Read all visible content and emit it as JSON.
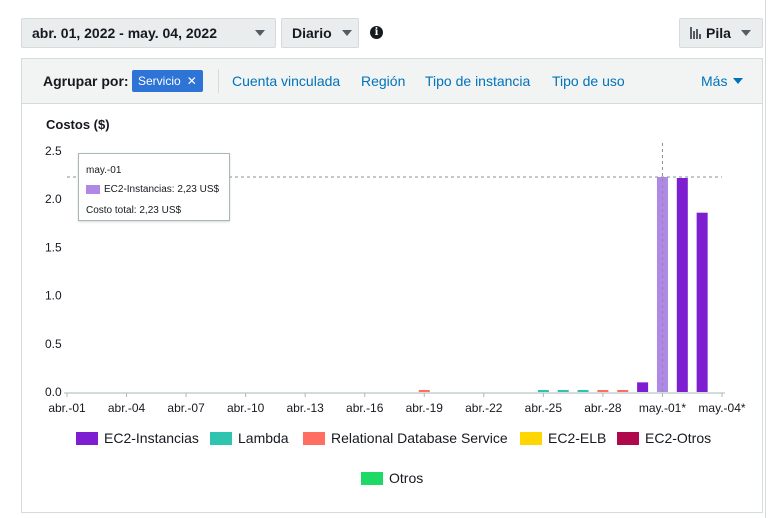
{
  "toolbar": {
    "date_range": "abr. 01, 2022 - may. 04, 2022",
    "granularity": "Diario",
    "chart_style": "Pila"
  },
  "group_by": {
    "label": "Agrupar por:",
    "chip": "Servicio",
    "links": [
      "Cuenta vinculada",
      "Región",
      "Tipo de instancia",
      "Tipo de uso"
    ],
    "more": "Más"
  },
  "tooltip": {
    "date": "may.-01",
    "series_line": "EC2-Instancias: 2,23 US$",
    "total_line": "Costo total: 2,23 US$"
  },
  "colors": {
    "EC2-Instancias": "#7d1fd1",
    "EC2-Instancias-highlight": "#b088e6",
    "Lambda": "#2ec4b0",
    "Relational Database Service": "#ff6e60",
    "EC2-ELB": "#ffd600",
    "EC2-Otros": "#b0084d",
    "Otros": "#1fd966"
  },
  "chart_data": {
    "type": "bar",
    "stacked": true,
    "title": "",
    "ylabel": "Costos ($)",
    "ylim": [
      0,
      2.5
    ],
    "yticks": [
      "0.0",
      "0.5",
      "1.0",
      "1.5",
      "2.0",
      "2.5"
    ],
    "x_tick_labels": [
      "abr.-01",
      "abr.-04",
      "abr.-07",
      "abr.-10",
      "abr.-13",
      "abr.-16",
      "abr.-19",
      "abr.-22",
      "abr.-25",
      "abr.-28",
      "may.-01*",
      "may.-04*"
    ],
    "categories": [
      "abr.-01",
      "abr.-02",
      "abr.-03",
      "abr.-04",
      "abr.-05",
      "abr.-06",
      "abr.-07",
      "abr.-08",
      "abr.-09",
      "abr.-10",
      "abr.-11",
      "abr.-12",
      "abr.-13",
      "abr.-14",
      "abr.-15",
      "abr.-16",
      "abr.-17",
      "abr.-18",
      "abr.-19",
      "abr.-20",
      "abr.-21",
      "abr.-22",
      "abr.-23",
      "abr.-24",
      "abr.-25",
      "abr.-26",
      "abr.-27",
      "abr.-28",
      "abr.-29",
      "abr.-30",
      "may.-01",
      "may.-02",
      "may.-03",
      "may.-04"
    ],
    "series": [
      {
        "name": "EC2-Instancias",
        "values": [
          0,
          0,
          0,
          0,
          0,
          0,
          0,
          0,
          0,
          0,
          0,
          0,
          0,
          0,
          0,
          0,
          0,
          0,
          0,
          0,
          0,
          0,
          0,
          0,
          0,
          0,
          0,
          0,
          0,
          0.1,
          2.23,
          2.22,
          1.86,
          0
        ]
      },
      {
        "name": "Lambda",
        "values": [
          0,
          0,
          0,
          0,
          0,
          0,
          0,
          0,
          0,
          0,
          0,
          0,
          0,
          0,
          0,
          0,
          0,
          0,
          0,
          0,
          0,
          0,
          0,
          0,
          0.01,
          0.01,
          0.01,
          0,
          0,
          0,
          0,
          0,
          0,
          0
        ]
      },
      {
        "name": "Relational Database Service",
        "values": [
          0,
          0,
          0,
          0,
          0,
          0,
          0,
          0,
          0,
          0,
          0,
          0,
          0,
          0,
          0,
          0,
          0,
          0,
          0.01,
          0,
          0,
          0,
          0,
          0,
          0,
          0,
          0,
          0.01,
          0.01,
          0,
          0,
          0,
          0,
          0
        ]
      },
      {
        "name": "EC2-ELB",
        "values": [
          0,
          0,
          0,
          0,
          0,
          0,
          0,
          0,
          0,
          0,
          0,
          0,
          0,
          0,
          0,
          0,
          0,
          0,
          0,
          0,
          0,
          0,
          0,
          0,
          0,
          0,
          0,
          0,
          0,
          0,
          0,
          0,
          0,
          0
        ]
      },
      {
        "name": "EC2-Otros",
        "values": [
          0,
          0,
          0,
          0,
          0,
          0,
          0,
          0,
          0,
          0,
          0,
          0,
          0,
          0,
          0,
          0,
          0,
          0,
          0,
          0,
          0,
          0,
          0,
          0,
          0,
          0,
          0,
          0,
          0,
          0,
          0,
          0,
          0,
          0
        ]
      },
      {
        "name": "Otros",
        "values": [
          0,
          0,
          0,
          0,
          0,
          0,
          0,
          0,
          0,
          0,
          0,
          0,
          0,
          0,
          0,
          0,
          0,
          0,
          0,
          0,
          0,
          0,
          0,
          0,
          0,
          0,
          0,
          0,
          0,
          0,
          0,
          0,
          0,
          0
        ]
      }
    ],
    "highlight_category": "may.-01",
    "reference_line": 2.23,
    "grid": false,
    "legend_position": "bottom"
  }
}
